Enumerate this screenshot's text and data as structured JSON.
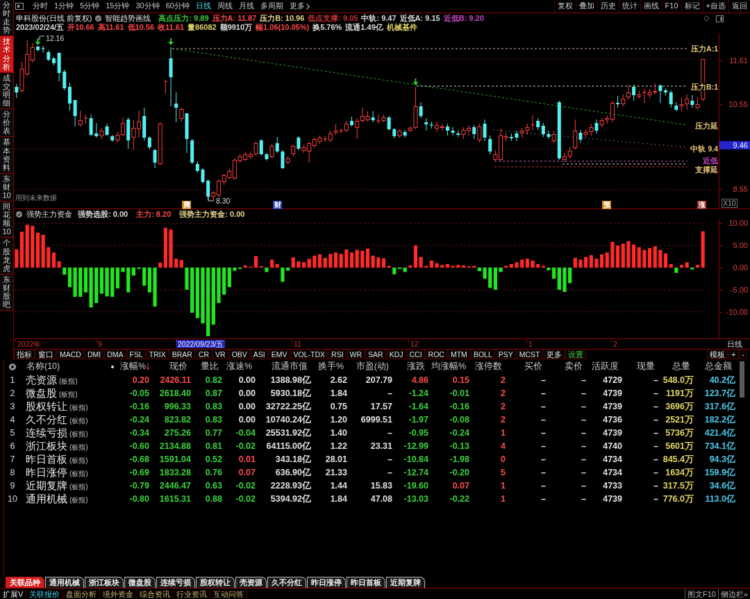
{
  "sidebar": {
    "items": [
      {
        "label": "分时走势",
        "selected": false
      },
      {
        "label": "技术分析",
        "selected": true
      },
      {
        "label": "成交明细",
        "selected": false
      },
      {
        "label": "分价表",
        "selected": false
      },
      {
        "label": "基本资料",
        "selected": false
      },
      {
        "label": "东财10",
        "selected": false
      },
      {
        "label": "同花顺10",
        "selected": false
      },
      {
        "label": "个股龙虎",
        "selected": false
      },
      {
        "label": "东财股吧",
        "selected": false
      }
    ]
  },
  "toolbar": {
    "periods": [
      {
        "label": "分时",
        "selected": false,
        "kind": "period"
      },
      {
        "label": "1分钟",
        "selected": false,
        "kind": "period"
      },
      {
        "label": "5分钟",
        "selected": false,
        "kind": "period"
      },
      {
        "label": "15分钟",
        "selected": false,
        "kind": "period"
      },
      {
        "label": "30分钟",
        "selected": false,
        "kind": "period"
      },
      {
        "label": "60分钟",
        "selected": false,
        "kind": "period"
      },
      {
        "label": "日线",
        "selected": true,
        "kind": "period"
      },
      {
        "label": "周线",
        "selected": false,
        "kind": "period"
      },
      {
        "label": "月线",
        "selected": false,
        "kind": "period"
      },
      {
        "label": "多周期",
        "selected": false,
        "kind": "period"
      },
      {
        "label": "更多",
        "selected": false,
        "kind": "menu"
      }
    ],
    "actions": [
      "复权",
      "叠加",
      "历史",
      "统计",
      "画线",
      "F10",
      "标记",
      "+自选",
      "返回"
    ]
  },
  "chart_header": {
    "title": "申科股份(日线 前复权)",
    "indicator": "智能趋势画线",
    "legend": [
      {
        "label": "高点压力: 9.89",
        "color": "#3cc83c"
      },
      {
        "label": "压力A: 11.87",
        "color": "#ff4646"
      },
      {
        "label": "压力B: 10.96",
        "color": "#e8d48a"
      },
      {
        "label": "低点支撑: 9.05",
        "color": "#c83232"
      },
      {
        "label": "中轨: 9.47",
        "color": "#dcdcdc"
      },
      {
        "label": "近低A: 9.15",
        "color": "#dcdcdc"
      },
      {
        "label": "近低B: 9.20",
        "color": "#c846c8"
      }
    ]
  },
  "quote": [
    {
      "text": "2023/02/24/五",
      "color": "#dcdcdc"
    },
    {
      "text": "开10.66",
      "color": "#ff4646"
    },
    {
      "text": "高11.61",
      "color": "#ff4646"
    },
    {
      "text": "低10.56",
      "color": "#ff4646"
    },
    {
      "text": "收11.61",
      "color": "#ff4646"
    },
    {
      "text": "量86082",
      "color": "#e2d466"
    },
    {
      "text": "额9910万",
      "color": "#dcdcdc"
    },
    {
      "text": "幅1.06(10.05%)",
      "color": "#ff4646"
    },
    {
      "text": "换5.76%",
      "color": "#dcdcdc"
    },
    {
      "text": "流通1.49亿",
      "color": "#dcdcdc"
    },
    {
      "text": "机械基件",
      "color": "#e2d466"
    }
  ],
  "price_chart": {
    "axis_labels": [
      {
        "text": "11.61",
        "kind": "tick"
      },
      {
        "text": "10.55",
        "kind": "tick"
      },
      {
        "text": "9.46",
        "kind": "cursor"
      },
      {
        "text": "8.55",
        "kind": "tick"
      }
    ],
    "zoom_label": "X10",
    "high_label": "12.16",
    "low_label": "8.30",
    "note": "用到未来数据",
    "level_labels": [
      {
        "text": "压力A:1",
        "color": "#e8c87a"
      },
      {
        "text": "压力B:1",
        "color": "#e8c87a"
      },
      {
        "text": "压力延",
        "color": "#e8c87a"
      },
      {
        "text": "中轨 9.4",
        "color": "#e8c87a"
      },
      {
        "text": "近低",
        "color": "#c846c8"
      },
      {
        "text": "支撑延",
        "color": "#e8c87a"
      }
    ],
    "event_markers": [
      {
        "text": "腾",
        "color": "#d08a1e"
      },
      {
        "text": "财",
        "color": "#2c46b4"
      },
      {
        "text": "预",
        "color": "#d08a1e"
      },
      {
        "text": "涨",
        "color": "#a02e22"
      }
    ]
  },
  "indicator": {
    "title": "强势主力资金",
    "readouts": [
      {
        "text": "强势选股: 0.00",
        "color": "#dcdcdc"
      },
      {
        "text": "主力: 8.20",
        "color": "#ff4646"
      },
      {
        "text": "强势主力资金: 0.00",
        "color": "#e8d48a"
      }
    ],
    "chart_data": {
      "type": "bar",
      "values": [
        4.1,
        8.1,
        9.7,
        9.4,
        7.9,
        7.4,
        4.6,
        3.4,
        1.4,
        -1.6,
        -4.4,
        -6.6,
        -6.6,
        -5.6,
        -9.0,
        -8.0,
        -5.9,
        -6.5,
        -6.6,
        -4.7,
        -1.0,
        -5.6,
        -1.8,
        -0.3,
        -4.1,
        -5.6,
        -8.8,
        1.1,
        9.0,
        8.6,
        2.0,
        1.7,
        -5.0,
        -10.2,
        -11.4,
        -12.6,
        -15.5,
        -12.9,
        -8.0,
        -6.1,
        -4.4,
        -0.7,
        -0.3,
        0.5,
        0.2,
        2.6,
        0.3,
        -1.0,
        1.8,
        0.8,
        -3.2,
        -0.7,
        2.3,
        1.4,
        1.2,
        2.0,
        2.7,
        3.0,
        2.2,
        3.1,
        3.4,
        3.1,
        4.1,
        3.4,
        4.0,
        3.8,
        4.3,
        2.7,
        2.3,
        2.1,
        0.4,
        -1.5,
        -0.3,
        -1.0,
        0.5,
        5.0,
        2.4,
        0.4,
        1.6,
        1.0,
        0.6,
        0.8,
        0.4,
        0.6,
        0.5,
        0.3,
        0.4,
        -0.8,
        -2.5,
        -4.6,
        -5.0,
        -1.0,
        0.4,
        0.8,
        1.2,
        1.8,
        2.0,
        1.6,
        0.8,
        0.4,
        -0.6,
        -2.5,
        -5.0,
        -5.5,
        -3.5,
        2.2,
        1.8,
        2.4,
        2.8,
        2.0,
        3.0,
        3.4,
        5.8,
        5.0,
        5.4,
        6.0,
        5.2,
        4.6,
        4.0,
        4.4,
        4.8,
        4.0,
        3.2,
        0.8,
        -1.2,
        0.6,
        1.2,
        -0.4,
        0.6,
        8.2
      ],
      "ylim": [
        -16,
        11
      ],
      "yticks": [
        {
          "value": 10,
          "label": "10.00"
        },
        {
          "value": 5,
          "label": "5.00"
        },
        {
          "value": 0,
          "label": "0.00"
        },
        {
          "value": -5,
          "label": "-5.00"
        },
        {
          "value": -10,
          "label": "-10.00"
        }
      ],
      "grid": true
    }
  },
  "date_axis": {
    "labels": [
      {
        "text": "2022年",
        "selected": false
      },
      {
        "text": "9",
        "selected": false
      },
      {
        "text": "2022/09/23/五",
        "selected": true
      },
      {
        "text": "11",
        "selected": false
      },
      {
        "text": "12",
        "selected": false
      },
      {
        "text": "1",
        "selected": false
      },
      {
        "text": "2",
        "selected": false
      }
    ],
    "period": "日线"
  },
  "indicator_tabs": {
    "items": [
      {
        "label": "指标",
        "kind": "tab"
      },
      {
        "label": "窗口",
        "kind": "tab"
      },
      {
        "label": "MACD",
        "kind": "tab"
      },
      {
        "label": "DMI",
        "kind": "tab"
      },
      {
        "label": "DMA",
        "kind": "tab"
      },
      {
        "label": "FSL",
        "kind": "tab"
      },
      {
        "label": "TRIX",
        "kind": "tab"
      },
      {
        "label": "BRAR",
        "kind": "tab"
      },
      {
        "label": "CR",
        "kind": "tab"
      },
      {
        "label": "VR",
        "kind": "tab"
      },
      {
        "label": "OBV",
        "kind": "tab"
      },
      {
        "label": "ASI",
        "kind": "tab"
      },
      {
        "label": "EMV",
        "kind": "tab"
      },
      {
        "label": "VOL-TDX",
        "kind": "tab"
      },
      {
        "label": "RSI",
        "kind": "tab"
      },
      {
        "label": "WR",
        "kind": "tab"
      },
      {
        "label": "SAR",
        "kind": "tab"
      },
      {
        "label": "KDJ",
        "kind": "tab"
      },
      {
        "label": "CCI",
        "kind": "tab"
      },
      {
        "label": "ROC",
        "kind": "tab"
      },
      {
        "label": "MTM",
        "kind": "tab"
      },
      {
        "label": "BOLL",
        "kind": "tab"
      },
      {
        "label": "PSY",
        "kind": "tab"
      },
      {
        "label": "MCST",
        "kind": "tab"
      },
      {
        "label": "更多",
        "kind": "tab"
      },
      {
        "label": "设置",
        "kind": "action"
      }
    ],
    "right": [
      "模板",
      "+",
      "-"
    ]
  },
  "table": {
    "name_header": "名称(10)",
    "columns": [
      {
        "label": "涨幅%",
        "sorted": true
      },
      {
        "label": "现价",
        "sorted": false
      },
      {
        "label": "量比",
        "sorted": false
      },
      {
        "label": "涨速%",
        "sorted": false
      },
      {
        "label": "流通市值",
        "sorted": false
      },
      {
        "label": "换手%",
        "sorted": false
      },
      {
        "label": "市盈(动)",
        "sorted": false
      },
      {
        "label": "涨跌",
        "sorted": false
      },
      {
        "label": "均涨幅%",
        "sorted": false
      },
      {
        "label": "涨停数",
        "sorted": false
      },
      {
        "label": "买价",
        "sorted": false
      },
      {
        "label": "卖价",
        "sorted": false
      },
      {
        "label": "活跃度",
        "sorted": false
      },
      {
        "label": "现量",
        "sorted": false
      },
      {
        "label": "总量",
        "sorted": false
      },
      {
        "label": "总金额",
        "sorted": false
      }
    ],
    "rows": [
      {
        "no": "1",
        "name": "壳资源",
        "tag": "(板指)",
        "cells": [
          {
            "text": "0.20",
            "color": "#ff4b4b"
          },
          {
            "text": "2426.11",
            "color": "#ff4b4b"
          },
          {
            "text": "0.82",
            "color": "#3cd23c"
          },
          {
            "text": "0.00",
            "color": "#e0e0e0"
          },
          {
            "text": "1388.98亿",
            "color": "#e0e0e0"
          },
          {
            "text": "2.62",
            "color": "#e0e0e0"
          },
          {
            "text": "207.79",
            "color": "#e0e0e0"
          },
          {
            "text": "4.86",
            "color": "#ff4b4b"
          },
          {
            "text": "0.15",
            "color": "#ff4b4b"
          },
          {
            "text": "2",
            "color": "#ff4b4b"
          },
          {
            "text": "–",
            "color": "#e0e0e0"
          },
          {
            "text": "–",
            "color": "#e0e0e0"
          },
          {
            "text": "4729",
            "color": "#e0e0e0"
          },
          {
            "text": "–",
            "color": "#e0e0e0"
          },
          {
            "text": "548.0万",
            "color": "#e2d466"
          },
          {
            "text": "40.2亿",
            "color": "#4ec8e8"
          }
        ]
      },
      {
        "no": "2",
        "name": "微盘股",
        "tag": "(板指)",
        "cells": [
          {
            "text": "-0.05",
            "color": "#3cd23c"
          },
          {
            "text": "2618.40",
            "color": "#3cd23c"
          },
          {
            "text": "0.87",
            "color": "#3cd23c"
          },
          {
            "text": "0.00",
            "color": "#e0e0e0"
          },
          {
            "text": "5930.18亿",
            "color": "#e0e0e0"
          },
          {
            "text": "1.84",
            "color": "#e0e0e0"
          },
          {
            "text": "–",
            "color": "#e0e0e0"
          },
          {
            "text": "-1.24",
            "color": "#3cd23c"
          },
          {
            "text": "-0.01",
            "color": "#3cd23c"
          },
          {
            "text": "2",
            "color": "#ff4b4b"
          },
          {
            "text": "–",
            "color": "#e0e0e0"
          },
          {
            "text": "–",
            "color": "#e0e0e0"
          },
          {
            "text": "4739",
            "color": "#e0e0e0"
          },
          {
            "text": "–",
            "color": "#e0e0e0"
          },
          {
            "text": "1191万",
            "color": "#e2d466"
          },
          {
            "text": "123.7亿",
            "color": "#4ec8e8"
          }
        ]
      },
      {
        "no": "3",
        "name": "股权转让",
        "tag": "(板指)",
        "cells": [
          {
            "text": "-0.16",
            "color": "#3cd23c"
          },
          {
            "text": "996.33",
            "color": "#3cd23c"
          },
          {
            "text": "0.83",
            "color": "#3cd23c"
          },
          {
            "text": "0.00",
            "color": "#e0e0e0"
          },
          {
            "text": "32722.25亿",
            "color": "#e0e0e0"
          },
          {
            "text": "0.75",
            "color": "#e0e0e0"
          },
          {
            "text": "17.57",
            "color": "#e0e0e0"
          },
          {
            "text": "-1.64",
            "color": "#3cd23c"
          },
          {
            "text": "-0.16",
            "color": "#3cd23c"
          },
          {
            "text": "2",
            "color": "#ff4b4b"
          },
          {
            "text": "–",
            "color": "#e0e0e0"
          },
          {
            "text": "–",
            "color": "#e0e0e0"
          },
          {
            "text": "4739",
            "color": "#e0e0e0"
          },
          {
            "text": "–",
            "color": "#e0e0e0"
          },
          {
            "text": "3696万",
            "color": "#e2d466"
          },
          {
            "text": "317.6亿",
            "color": "#4ec8e8"
          }
        ]
      },
      {
        "no": "4",
        "name": "久不分红",
        "tag": "(板指)",
        "cells": [
          {
            "text": "-0.24",
            "color": "#3cd23c"
          },
          {
            "text": "823.82",
            "color": "#3cd23c"
          },
          {
            "text": "0.83",
            "color": "#3cd23c"
          },
          {
            "text": "0.00",
            "color": "#e0e0e0"
          },
          {
            "text": "10740.24亿",
            "color": "#e0e0e0"
          },
          {
            "text": "1.20",
            "color": "#e0e0e0"
          },
          {
            "text": "6999.51",
            "color": "#e0e0e0"
          },
          {
            "text": "-1.97",
            "color": "#3cd23c"
          },
          {
            "text": "-0.08",
            "color": "#3cd23c"
          },
          {
            "text": "2",
            "color": "#ff4b4b"
          },
          {
            "text": "–",
            "color": "#e0e0e0"
          },
          {
            "text": "–",
            "color": "#e0e0e0"
          },
          {
            "text": "4736",
            "color": "#e0e0e0"
          },
          {
            "text": "–",
            "color": "#e0e0e0"
          },
          {
            "text": "2521万",
            "color": "#e2d466"
          },
          {
            "text": "182.2亿",
            "color": "#4ec8e8"
          }
        ]
      },
      {
        "no": "5",
        "name": "连续亏损",
        "tag": "(板指)",
        "cells": [
          {
            "text": "-0.34",
            "color": "#3cd23c"
          },
          {
            "text": "275.26",
            "color": "#3cd23c"
          },
          {
            "text": "0.77",
            "color": "#3cd23c"
          },
          {
            "text": "-0.04",
            "color": "#3cd23c"
          },
          {
            "text": "25531.92亿",
            "color": "#e0e0e0"
          },
          {
            "text": "1.40",
            "color": "#e0e0e0"
          },
          {
            "text": "–",
            "color": "#e0e0e0"
          },
          {
            "text": "-0.95",
            "color": "#3cd23c"
          },
          {
            "text": "-0.24",
            "color": "#3cd23c"
          },
          {
            "text": "1",
            "color": "#ff4b4b"
          },
          {
            "text": "–",
            "color": "#e0e0e0"
          },
          {
            "text": "–",
            "color": "#e0e0e0"
          },
          {
            "text": "4739",
            "color": "#e0e0e0"
          },
          {
            "text": "–",
            "color": "#e0e0e0"
          },
          {
            "text": "5736万",
            "color": "#e2d466"
          },
          {
            "text": "421.4亿",
            "color": "#4ec8e8"
          }
        ]
      },
      {
        "no": "6",
        "name": "浙江板块",
        "tag": "(板指)",
        "cells": [
          {
            "text": "-0.60",
            "color": "#3cd23c"
          },
          {
            "text": "2134.88",
            "color": "#3cd23c"
          },
          {
            "text": "0.81",
            "color": "#3cd23c"
          },
          {
            "text": "-0.02",
            "color": "#3cd23c"
          },
          {
            "text": "64115.00亿",
            "color": "#e0e0e0"
          },
          {
            "text": "1.22",
            "color": "#e0e0e0"
          },
          {
            "text": "23.31",
            "color": "#e0e0e0"
          },
          {
            "text": "-12.99",
            "color": "#3cd23c"
          },
          {
            "text": "-0.13",
            "color": "#3cd23c"
          },
          {
            "text": "4",
            "color": "#ff4b4b"
          },
          {
            "text": "–",
            "color": "#e0e0e0"
          },
          {
            "text": "–",
            "color": "#e0e0e0"
          },
          {
            "text": "4740",
            "color": "#e0e0e0"
          },
          {
            "text": "–",
            "color": "#e0e0e0"
          },
          {
            "text": "5601万",
            "color": "#e2d466"
          },
          {
            "text": "734.1亿",
            "color": "#4ec8e8"
          }
        ]
      },
      {
        "no": "7",
        "name": "昨日首板",
        "tag": "(板指)",
        "cells": [
          {
            "text": "-0.68",
            "color": "#3cd23c"
          },
          {
            "text": "1591.04",
            "color": "#3cd23c"
          },
          {
            "text": "0.52",
            "color": "#3cd23c"
          },
          {
            "text": "0.01",
            "color": "#ff4b4b"
          },
          {
            "text": "343.18亿",
            "color": "#e0e0e0"
          },
          {
            "text": "28.01",
            "color": "#e0e0e0"
          },
          {
            "text": "–",
            "color": "#e0e0e0"
          },
          {
            "text": "-10.84",
            "color": "#3cd23c"
          },
          {
            "text": "-1.98",
            "color": "#3cd23c"
          },
          {
            "text": "0",
            "color": "#ff4b4b"
          },
          {
            "text": "–",
            "color": "#e0e0e0"
          },
          {
            "text": "–",
            "color": "#e0e0e0"
          },
          {
            "text": "4734",
            "color": "#e0e0e0"
          },
          {
            "text": "–",
            "color": "#e0e0e0"
          },
          {
            "text": "845.4万",
            "color": "#e2d466"
          },
          {
            "text": "94.3亿",
            "color": "#4ec8e8"
          }
        ]
      },
      {
        "no": "8",
        "name": "昨日涨停",
        "tag": "(板指)",
        "cells": [
          {
            "text": "-0.69",
            "color": "#3cd23c"
          },
          {
            "text": "1833.28",
            "color": "#3cd23c"
          },
          {
            "text": "0.76",
            "color": "#3cd23c"
          },
          {
            "text": "0.07",
            "color": "#ff4b4b"
          },
          {
            "text": "636.90亿",
            "color": "#e0e0e0"
          },
          {
            "text": "21.33",
            "color": "#e0e0e0"
          },
          {
            "text": "–",
            "color": "#e0e0e0"
          },
          {
            "text": "-12.74",
            "color": "#3cd23c"
          },
          {
            "text": "-0.20",
            "color": "#3cd23c"
          },
          {
            "text": "5",
            "color": "#ff4b4b"
          },
          {
            "text": "–",
            "color": "#e0e0e0"
          },
          {
            "text": "–",
            "color": "#e0e0e0"
          },
          {
            "text": "4734",
            "color": "#e0e0e0"
          },
          {
            "text": "–",
            "color": "#e0e0e0"
          },
          {
            "text": "1634万",
            "color": "#e2d466"
          },
          {
            "text": "159.9亿",
            "color": "#4ec8e8"
          }
        ]
      },
      {
        "no": "9",
        "name": "近期复牌",
        "tag": "(板指)",
        "cells": [
          {
            "text": "-0.79",
            "color": "#3cd23c"
          },
          {
            "text": "2446.47",
            "color": "#3cd23c"
          },
          {
            "text": "0.63",
            "color": "#3cd23c"
          },
          {
            "text": "-0.02",
            "color": "#3cd23c"
          },
          {
            "text": "2228.93亿",
            "color": "#e0e0e0"
          },
          {
            "text": "1.44",
            "color": "#e0e0e0"
          },
          {
            "text": "15.83",
            "color": "#e0e0e0"
          },
          {
            "text": "-19.60",
            "color": "#3cd23c"
          },
          {
            "text": "0.07",
            "color": "#ff4b4b"
          },
          {
            "text": "1",
            "color": "#ff4b4b"
          },
          {
            "text": "–",
            "color": "#e0e0e0"
          },
          {
            "text": "–",
            "color": "#e0e0e0"
          },
          {
            "text": "4733",
            "color": "#e0e0e0"
          },
          {
            "text": "–",
            "color": "#e0e0e0"
          },
          {
            "text": "317.5万",
            "color": "#e2d466"
          },
          {
            "text": "34.6亿",
            "color": "#4ec8e8"
          }
        ]
      },
      {
        "no": "10",
        "name": "通用机械",
        "tag": "(板指)",
        "cells": [
          {
            "text": "-0.80",
            "color": "#3cd23c"
          },
          {
            "text": "1615.31",
            "color": "#3cd23c"
          },
          {
            "text": "0.88",
            "color": "#3cd23c"
          },
          {
            "text": "-0.02",
            "color": "#3cd23c"
          },
          {
            "text": "5394.92亿",
            "color": "#e0e0e0"
          },
          {
            "text": "1.84",
            "color": "#e0e0e0"
          },
          {
            "text": "47.08",
            "color": "#e0e0e0"
          },
          {
            "text": "-13.03",
            "color": "#3cd23c"
          },
          {
            "text": "-0.22",
            "color": "#3cd23c"
          },
          {
            "text": "1",
            "color": "#ff4b4b"
          },
          {
            "text": "–",
            "color": "#e0e0e0"
          },
          {
            "text": "–",
            "color": "#e0e0e0"
          },
          {
            "text": "4739",
            "color": "#e0e0e0"
          },
          {
            "text": "–",
            "color": "#e0e0e0"
          },
          {
            "text": "776.0万",
            "color": "#e2d466"
          },
          {
            "text": "113.0亿",
            "color": "#4ec8e8"
          }
        ]
      }
    ]
  },
  "related_tabs": [
    {
      "label": "关联品种",
      "selected": true
    },
    {
      "label": "通用机械",
      "selected": false
    },
    {
      "label": "浙江板块",
      "selected": false
    },
    {
      "label": "微盘股",
      "selected": false
    },
    {
      "label": "连续亏损",
      "selected": false
    },
    {
      "label": "股权转让",
      "selected": false
    },
    {
      "label": "壳资源",
      "selected": false
    },
    {
      "label": "久不分红",
      "selected": false
    },
    {
      "label": "昨日涨停",
      "selected": false
    },
    {
      "label": "昨日首板",
      "selected": false
    },
    {
      "label": "近期复牌",
      "selected": false
    }
  ],
  "bottom_bar": {
    "items": [
      {
        "label": "扩展V",
        "kind": "menu",
        "selected": false
      },
      {
        "label": "关联报价",
        "kind": "tab",
        "selected": true
      },
      {
        "label": "盘面分析",
        "kind": "tab",
        "selected": false
      },
      {
        "label": "境外资金",
        "kind": "tab",
        "selected": false
      },
      {
        "label": "综合资讯",
        "kind": "tab",
        "selected": false
      },
      {
        "label": "行业资讯",
        "kind": "tab",
        "selected": false
      },
      {
        "label": "互动问答",
        "kind": "tab",
        "selected": false
      }
    ],
    "right": [
      "图文F10",
      "侧边栏»"
    ]
  }
}
